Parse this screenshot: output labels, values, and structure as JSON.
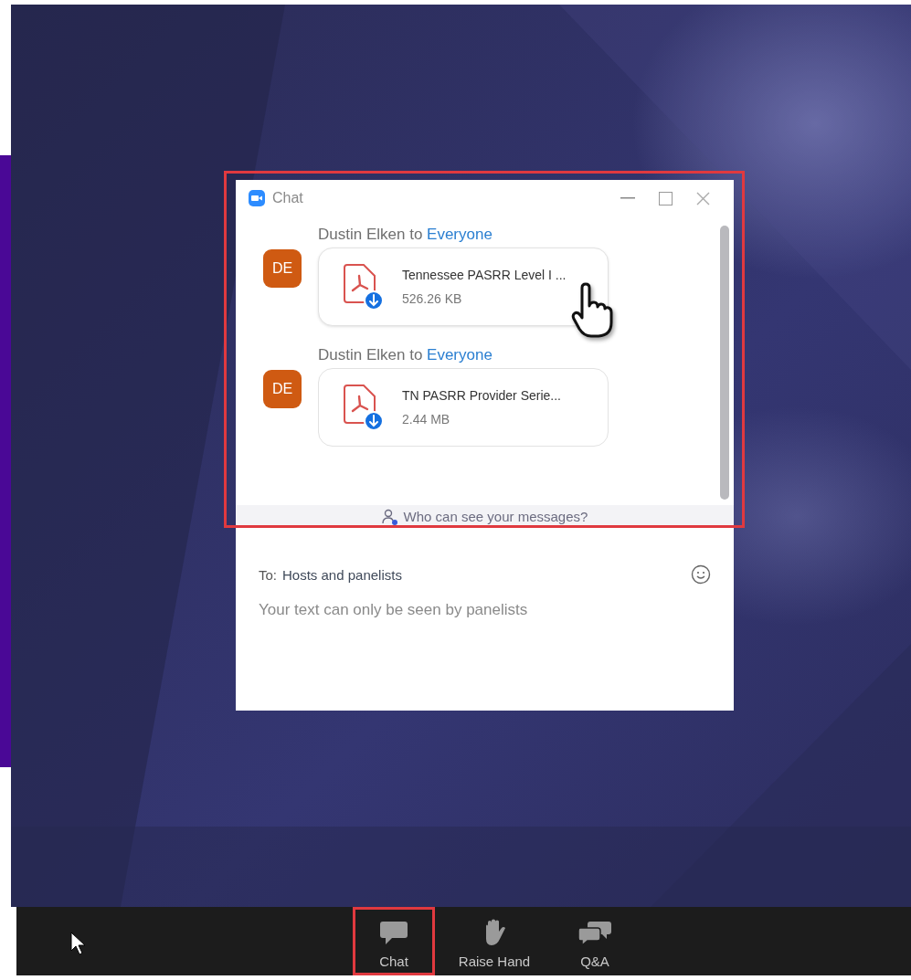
{
  "chat_window": {
    "title": "Chat",
    "highlighted": true,
    "messages": [
      {
        "sender": "Dustin Elken",
        "connector": "to",
        "recipient": "Everyone",
        "avatar": "DE",
        "file_name": "Tennessee PASRR Level I ...",
        "file_size": "526.26 KB",
        "hovered": true
      },
      {
        "sender": "Dustin Elken",
        "connector": "to",
        "recipient": "Everyone",
        "avatar": "DE",
        "file_name": "TN PASRR Provider Serie...",
        "file_size": "2.44 MB",
        "hovered": false
      }
    ],
    "privacy_link": "Who can see your messages?",
    "to_label": "To:",
    "to_value": "Hosts and panelists",
    "placeholder": "Your text can only be seen by panelists"
  },
  "toolbar": [
    {
      "kind": "chat",
      "label": "Chat",
      "highlighted": true
    },
    {
      "kind": "hand",
      "label": "Raise Hand",
      "highlighted": false
    },
    {
      "kind": "qa",
      "label": "Q&A",
      "highlighted": false
    }
  ]
}
